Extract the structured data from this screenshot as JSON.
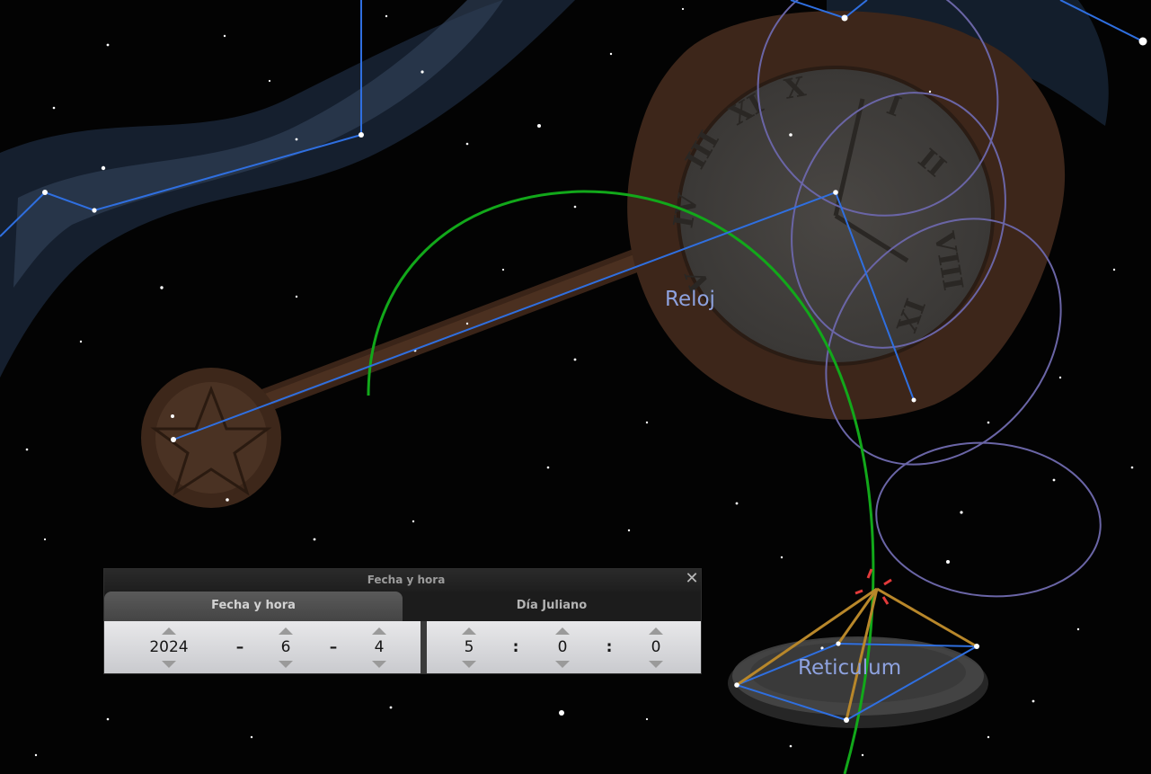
{
  "sky": {
    "constellation_labels": [
      "Reloj",
      "Reticulum"
    ]
  },
  "dialog": {
    "title": "Fecha y hora",
    "close_glyph": "✕",
    "tabs": [
      {
        "label": "Fecha y hora",
        "active": true
      },
      {
        "label": "Día Juliano",
        "active": false
      }
    ],
    "date": {
      "year": "2024",
      "month": "6",
      "day": "4",
      "separator": "–"
    },
    "time": {
      "hour": "5",
      "minute": "0",
      "second": "0",
      "separator": ":"
    }
  },
  "colors": {
    "sky_background": "#030303",
    "constellation_lines": "#2f6fe0",
    "meridian_arc": "#12a81a",
    "orbit_loops": "#6a65a6",
    "radiant_lines": "#b8872a",
    "radiant_marker": "#e23a3a",
    "label_color": "#8ea2df"
  },
  "icons": {
    "close": "close-icon",
    "spin_up": "chevron-up-icon",
    "spin_down": "chevron-down-icon"
  }
}
